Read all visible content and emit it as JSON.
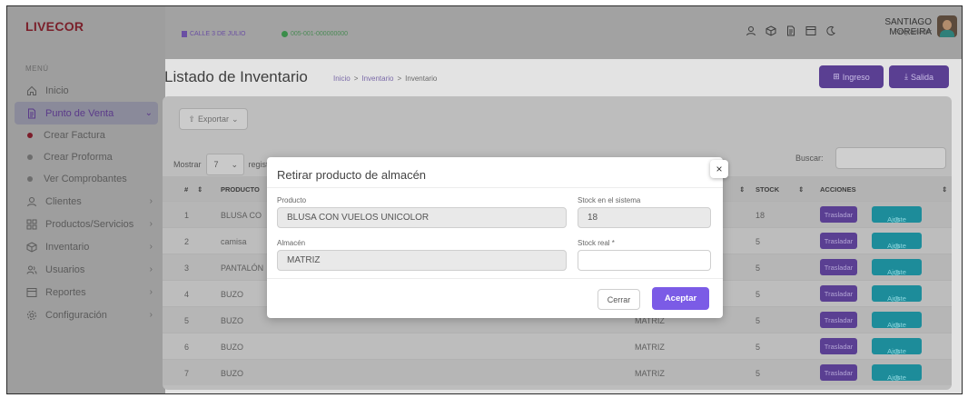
{
  "app": {
    "name": "LIVECOR"
  },
  "sidebar": {
    "menu_label": "MENÚ",
    "items": [
      {
        "label": "Inicio",
        "icon": "home-icon",
        "chevron": ""
      },
      {
        "label": "Punto de Venta",
        "icon": "document-icon",
        "chevron": "⌄",
        "active": true
      },
      {
        "label": "Clientes",
        "icon": "user-icon",
        "chevron": "›"
      },
      {
        "label": "Productos/Servicios",
        "icon": "grid-icon",
        "chevron": "›"
      },
      {
        "label": "Inventario",
        "icon": "box-icon",
        "chevron": "›"
      },
      {
        "label": "Usuarios",
        "icon": "users-icon",
        "chevron": "›"
      },
      {
        "label": "Reportes",
        "icon": "report-icon",
        "chevron": "›"
      },
      {
        "label": "Configuración",
        "icon": "gear-icon",
        "chevron": "›"
      }
    ],
    "subitems": [
      {
        "label": "Crear Factura",
        "active": true
      },
      {
        "label": "Crear Proforma"
      },
      {
        "label": "Ver Comprobantes"
      }
    ]
  },
  "topbar": {
    "location": "CALLE 3 DE JULIO",
    "code": "005-001-000000000",
    "user_name": "SANTIAGO MOREIRA",
    "user_role": "Programador",
    "icons": [
      "user-icon",
      "box-icon",
      "document-icon",
      "report-icon",
      "moon-icon"
    ]
  },
  "page": {
    "title": "Listado de Inventario",
    "breadcrumb": [
      "Inicio",
      ">",
      "Inventario",
      ">",
      "Inventario"
    ],
    "ingreso_label": "Ingreso",
    "salida_label": "Salida"
  },
  "table_controls": {
    "export_label": "Exportar",
    "show_label": "Mostrar",
    "show_value": "7",
    "records_label": "registros",
    "search_label": "Buscar:"
  },
  "table": {
    "headers": [
      "#",
      "PRODUCTO",
      "STOCK",
      "ACCIONES"
    ],
    "rows": [
      {
        "n": "1",
        "producto": "BLUSA CO",
        "almacen": "",
        "stock": "18"
      },
      {
        "n": "2",
        "producto": "camisa",
        "almacen": "",
        "stock": "5"
      },
      {
        "n": "3",
        "producto": "PANTALÓN",
        "almacen": "",
        "stock": "5"
      },
      {
        "n": "4",
        "producto": "BUZO",
        "almacen": "",
        "stock": "5"
      },
      {
        "n": "5",
        "producto": "BUZO",
        "almacen": "MATRIZ",
        "stock": "5"
      },
      {
        "n": "6",
        "producto": "BUZO",
        "almacen": "MATRIZ",
        "stock": "5"
      },
      {
        "n": "7",
        "producto": "BUZO",
        "almacen": "MATRIZ",
        "stock": "5"
      }
    ],
    "trasladar_label": "Trasladar",
    "ajuste_label": "Ajuste"
  },
  "modal": {
    "title": "Retirar producto de almacén",
    "close_glyph": "×",
    "producto_label": "Producto",
    "producto_value": "BLUSA CON VUELOS UNICOLOR",
    "stock_sistema_label": "Stock en el sistema",
    "stock_sistema_value": "18",
    "almacen_label": "Almacén",
    "almacen_value": "MATRIZ",
    "stock_real_label": "Stock real *",
    "stock_real_value": "",
    "cerrar_label": "Cerrar",
    "aceptar_label": "Aceptar"
  },
  "colors": {
    "brand": "#7a1f2a",
    "primary": "#7b5be6",
    "teal": "#1d8c9a"
  }
}
